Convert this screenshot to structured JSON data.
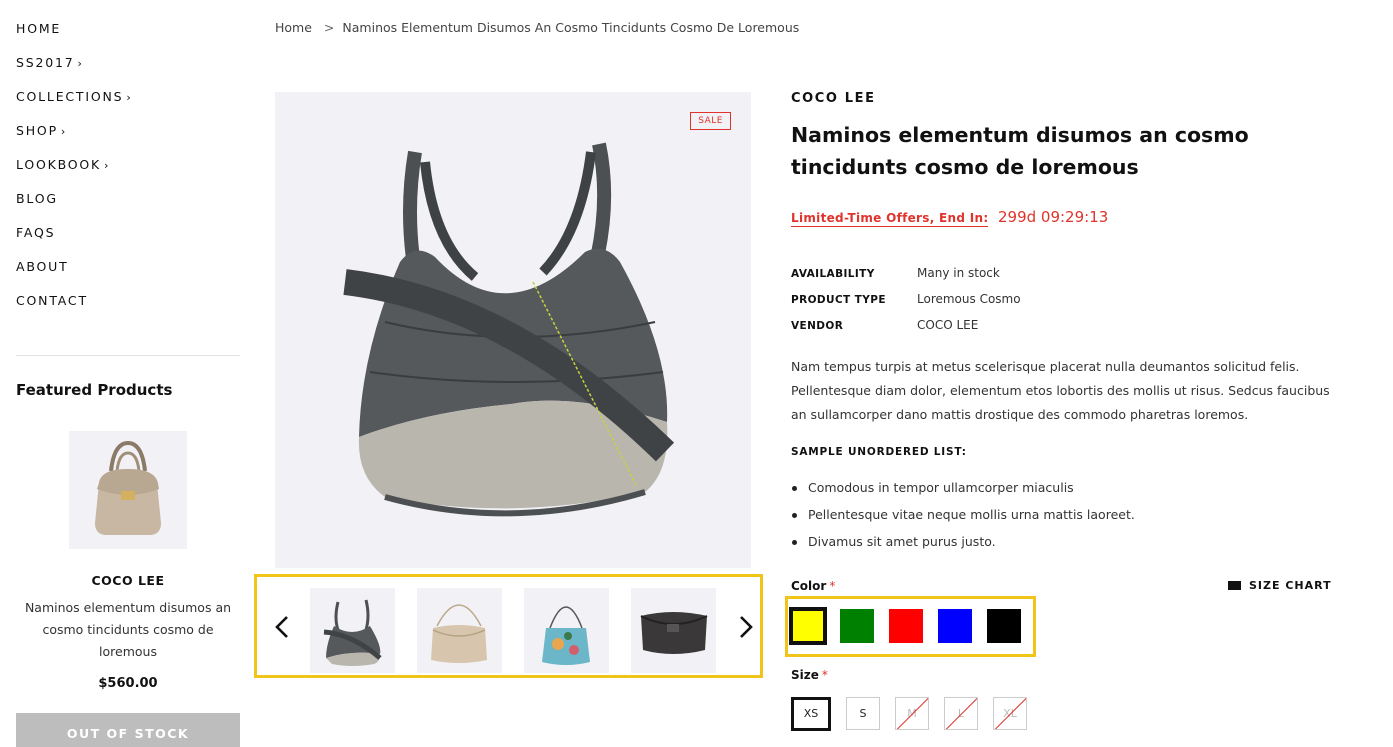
{
  "nav": {
    "items": [
      {
        "label": "HOME",
        "chevron": ""
      },
      {
        "label": "SS2017",
        "chevron": "›"
      },
      {
        "label": "COLLECTIONS",
        "chevron": "›"
      },
      {
        "label": "SHOP",
        "chevron": "›"
      },
      {
        "label": "LOOKBOOK",
        "chevron": "›"
      },
      {
        "label": "BLOG",
        "chevron": ""
      },
      {
        "label": "FAQS",
        "chevron": ""
      },
      {
        "label": "ABOUT",
        "chevron": ""
      },
      {
        "label": "CONTACT",
        "chevron": ""
      }
    ]
  },
  "featured": {
    "title": "Featured Products",
    "vendor": "COCO LEE",
    "name": "Naminos elementum disumos an cosmo tincidunts cosmo de loremous",
    "price": "$560.00",
    "button": "OUT OF STOCK"
  },
  "breadcrumb": {
    "home": "Home",
    "separator": ">",
    "current": "Naminos Elementum Disumos An Cosmo Tincidunts Cosmo De Loremous"
  },
  "gallery": {
    "badge": "SALE",
    "prev_icon": "chevron-left-icon",
    "next_icon": "chevron-right-icon",
    "thumbnails": [
      "gray-hobo-bag",
      "beige-shoulder-bag",
      "floral-tote-bag",
      "black-leather-clutch"
    ]
  },
  "product": {
    "vendor": "COCO LEE",
    "title": "Naminos elementum disumos an cosmo tincidunts cosmo de loremous",
    "offer_label": "Limited-Time Offers, End In:",
    "offer_timer": "299d 09:29:13",
    "meta": [
      {
        "key": "AVAILABILITY",
        "value": "Many in stock"
      },
      {
        "key": "PRODUCT TYPE",
        "value": "Loremous Cosmo"
      },
      {
        "key": "VENDOR",
        "value": "COCO LEE"
      }
    ],
    "description": "Nam tempus turpis at metus scelerisque placerat nulla deumantos solicitud felis. Pellentesque diam dolor, elementum etos lobortis des mollis ut risus. Sedcus faucibus an sullamcorper dano mattis drostique des commodo pharetras loremos.",
    "list_title": "SAMPLE UNORDERED LIST:",
    "list": [
      "Comodous in tempor ullamcorper miaculis",
      "Pellentesque vitae neque mollis urna mattis laoreet.",
      "Divamus sit amet purus justo."
    ]
  },
  "options": {
    "color_label": "Color",
    "size_label": "Size",
    "required_mark": "*",
    "size_chart": "SIZE CHART",
    "colors": [
      {
        "name": "yellow",
        "hex": "#ffff00",
        "selected": true
      },
      {
        "name": "green",
        "hex": "#008000",
        "selected": false
      },
      {
        "name": "red",
        "hex": "#ff0000",
        "selected": false
      },
      {
        "name": "blue",
        "hex": "#0000ff",
        "selected": false
      },
      {
        "name": "black",
        "hex": "#000000",
        "selected": false
      }
    ],
    "sizes": [
      {
        "label": "XS",
        "selected": true,
        "available": true
      },
      {
        "label": "S",
        "selected": false,
        "available": true
      },
      {
        "label": "M",
        "selected": false,
        "available": false
      },
      {
        "label": "L",
        "selected": false,
        "available": false
      },
      {
        "label": "XL",
        "selected": false,
        "available": false
      }
    ]
  },
  "colors": {
    "accent": "#e0332b",
    "highlight": "#f0c419",
    "image_bg": "#f2f2f6"
  }
}
